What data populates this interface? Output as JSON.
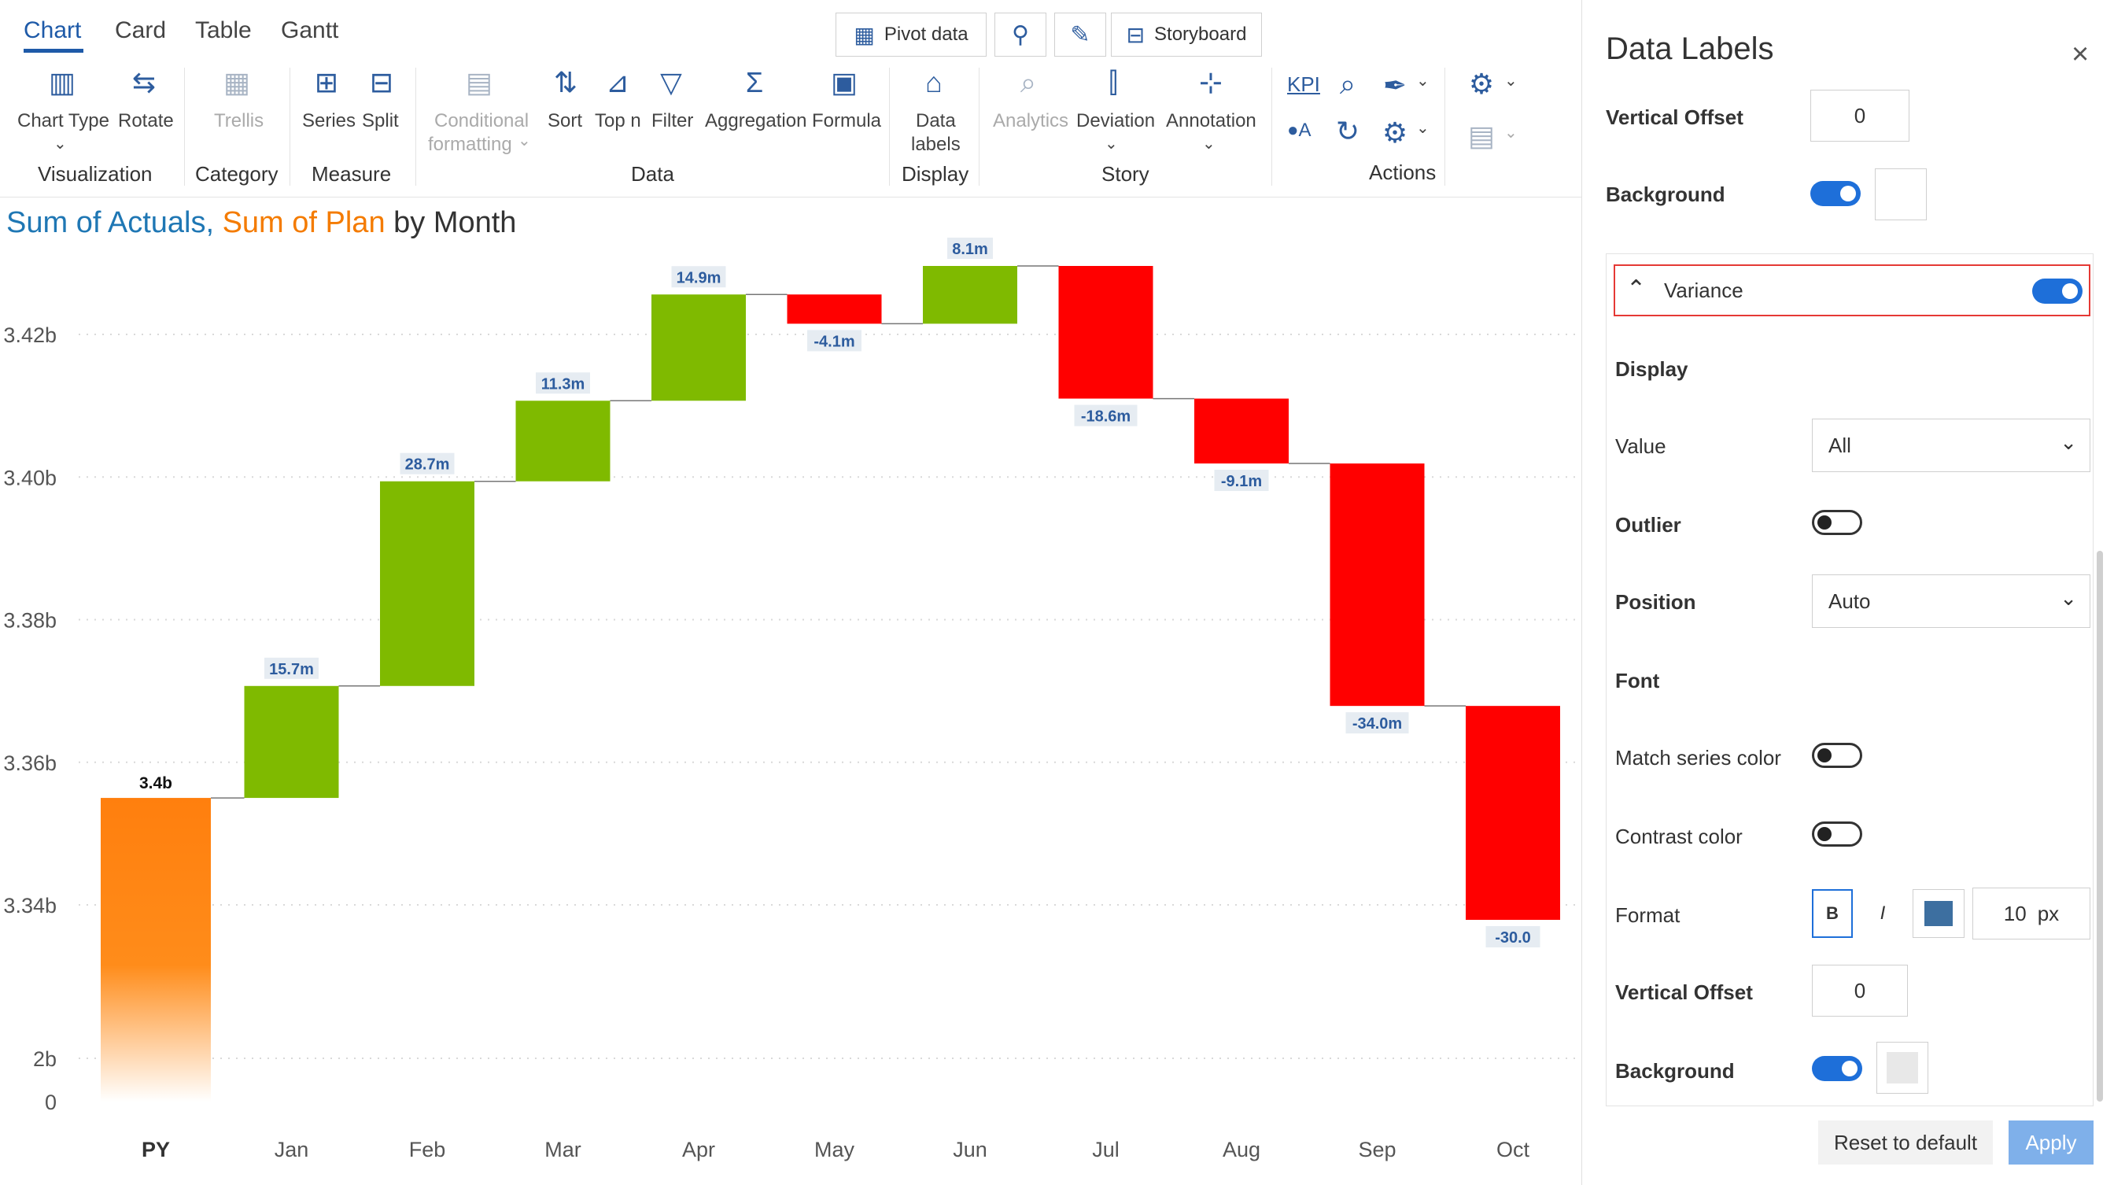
{
  "tabs": [
    "Chart",
    "Card",
    "Table",
    "Gantt"
  ],
  "top_buttons": {
    "pivot": "Pivot data",
    "storyboard": "Storyboard"
  },
  "toolbar": {
    "chart_type": "Chart Type",
    "rotate": "Rotate",
    "trellis": "Trellis",
    "series": "Series",
    "split": "Split",
    "conditional_1": "Conditional",
    "conditional_2": "formatting",
    "sort": "Sort",
    "top_n": "Top n",
    "filter": "Filter",
    "aggregation": "Aggregation",
    "formula": "Formula",
    "data_labels_1": "Data",
    "data_labels_2": "labels",
    "analytics": "Analytics",
    "deviation": "Deviation",
    "annotation": "Annotation",
    "kpi": "KPI",
    "a_label": "A"
  },
  "groups": {
    "visualization": "Visualization",
    "category": "Category",
    "measure": "Measure",
    "data": "Data",
    "display": "Display",
    "story": "Story",
    "actions": "Actions"
  },
  "chart_title": {
    "part1": "Sum of Actuals,",
    "part2": "Sum of Plan",
    "part3": "by Month"
  },
  "colors": {
    "actual": "#1f77b4",
    "plan": "#f47b00",
    "positive": "#7fba00",
    "negative": "#ff0000",
    "accent": "#1e6fd9",
    "label_text": "#2d5c9e"
  },
  "chart_data": {
    "type": "waterfall",
    "title": "Sum of Actuals, Sum of Plan by Month",
    "categories": [
      "PY",
      "Jan",
      "Feb",
      "Mar",
      "Apr",
      "May",
      "Jun",
      "Jul",
      "Aug",
      "Sep",
      "Oct"
    ],
    "start": {
      "category": "PY",
      "value": 3355000000,
      "label": "3.4b"
    },
    "deltas": [
      15700000,
      28700000,
      11300000,
      14900000,
      -4100000,
      8100000,
      -18600000,
      -9100000,
      -34000000,
      -30000000
    ],
    "delta_labels": [
      "15.7m",
      "28.7m",
      "11.3m",
      "14.9m",
      "-4.1m",
      "8.1m",
      "-18.6m",
      "-9.1m",
      "-34.0m",
      "-30.0"
    ],
    "y_ticks": [
      "3.42b",
      "3.40b",
      "3.38b",
      "3.36b",
      "3.34b",
      "2b",
      "0"
    ],
    "axis_break": true,
    "grid": true
  },
  "panel": {
    "title": "Data Labels",
    "top_vertical_offset_label": "Vertical Offset",
    "top_vertical_offset_value": "0",
    "top_background_label": "Background",
    "variance_label": "Variance",
    "display_label": "Display",
    "value_label": "Value",
    "value_selected": "All",
    "outlier_label": "Outlier",
    "position_label": "Position",
    "position_selected": "Auto",
    "font_label": "Font",
    "match_series_label": "Match series color",
    "contrast_label": "Contrast color",
    "format_label": "Format",
    "bold": "B",
    "italic": "I",
    "font_color": "#3d6fa0",
    "font_size": "10",
    "font_unit": "px",
    "vertical_offset_label": "Vertical Offset",
    "vertical_offset_value": "0",
    "background_label": "Background",
    "reset_label": "Reset to default",
    "apply_label": "Apply"
  }
}
